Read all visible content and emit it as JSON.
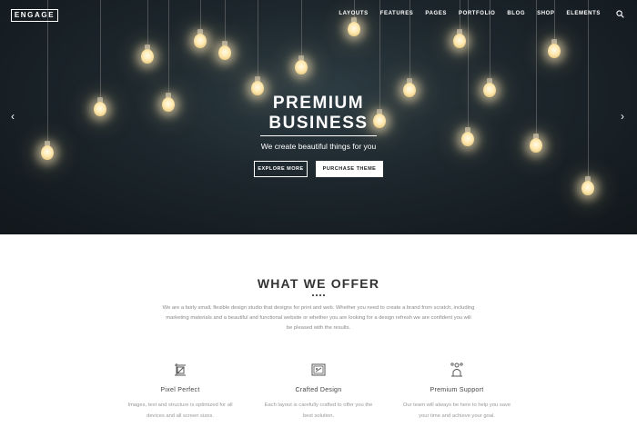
{
  "header": {
    "logo": "ENGAGE",
    "nav": [
      "LAYOUTS",
      "FEATURES",
      "PAGES",
      "PORTFOLIO",
      "BLOG",
      "SHOP",
      "ELEMENTS"
    ]
  },
  "hero": {
    "title_line1": "PREMIUM",
    "title_line2": "BUSINESS",
    "subtitle": "We create beautiful things for you",
    "buttons": {
      "explore": "EXPLORE MORE",
      "purchase": "PURCHASE THEME"
    }
  },
  "offer": {
    "title": "WHAT WE OFFER",
    "intro_line1": "We are a fairly small, flexible design studio that designs for print and web. Whether you need to create a brand from scratch, including",
    "intro_line2": "marketing materials and a beautiful and functional website or whether you are looking for a design refresh we are confident you will",
    "intro_line3": "be pleased with the results.",
    "features": [
      {
        "icon": "pixel-icon",
        "title": "Pixel Perfect",
        "desc_line1": "Images, text and structure is optimized for all",
        "desc_line2": "devices and all screen sizes."
      },
      {
        "icon": "crafted-icon",
        "title": "Crafted Design",
        "desc_line1": "Each layout is carefully crafted to offer you the",
        "desc_line2": "best solution."
      },
      {
        "icon": "support-icon",
        "title": "Premium Support",
        "desc_line1": "Our team will always be here to help you save",
        "desc_line2": "your time and achieve your goal."
      }
    ]
  }
}
